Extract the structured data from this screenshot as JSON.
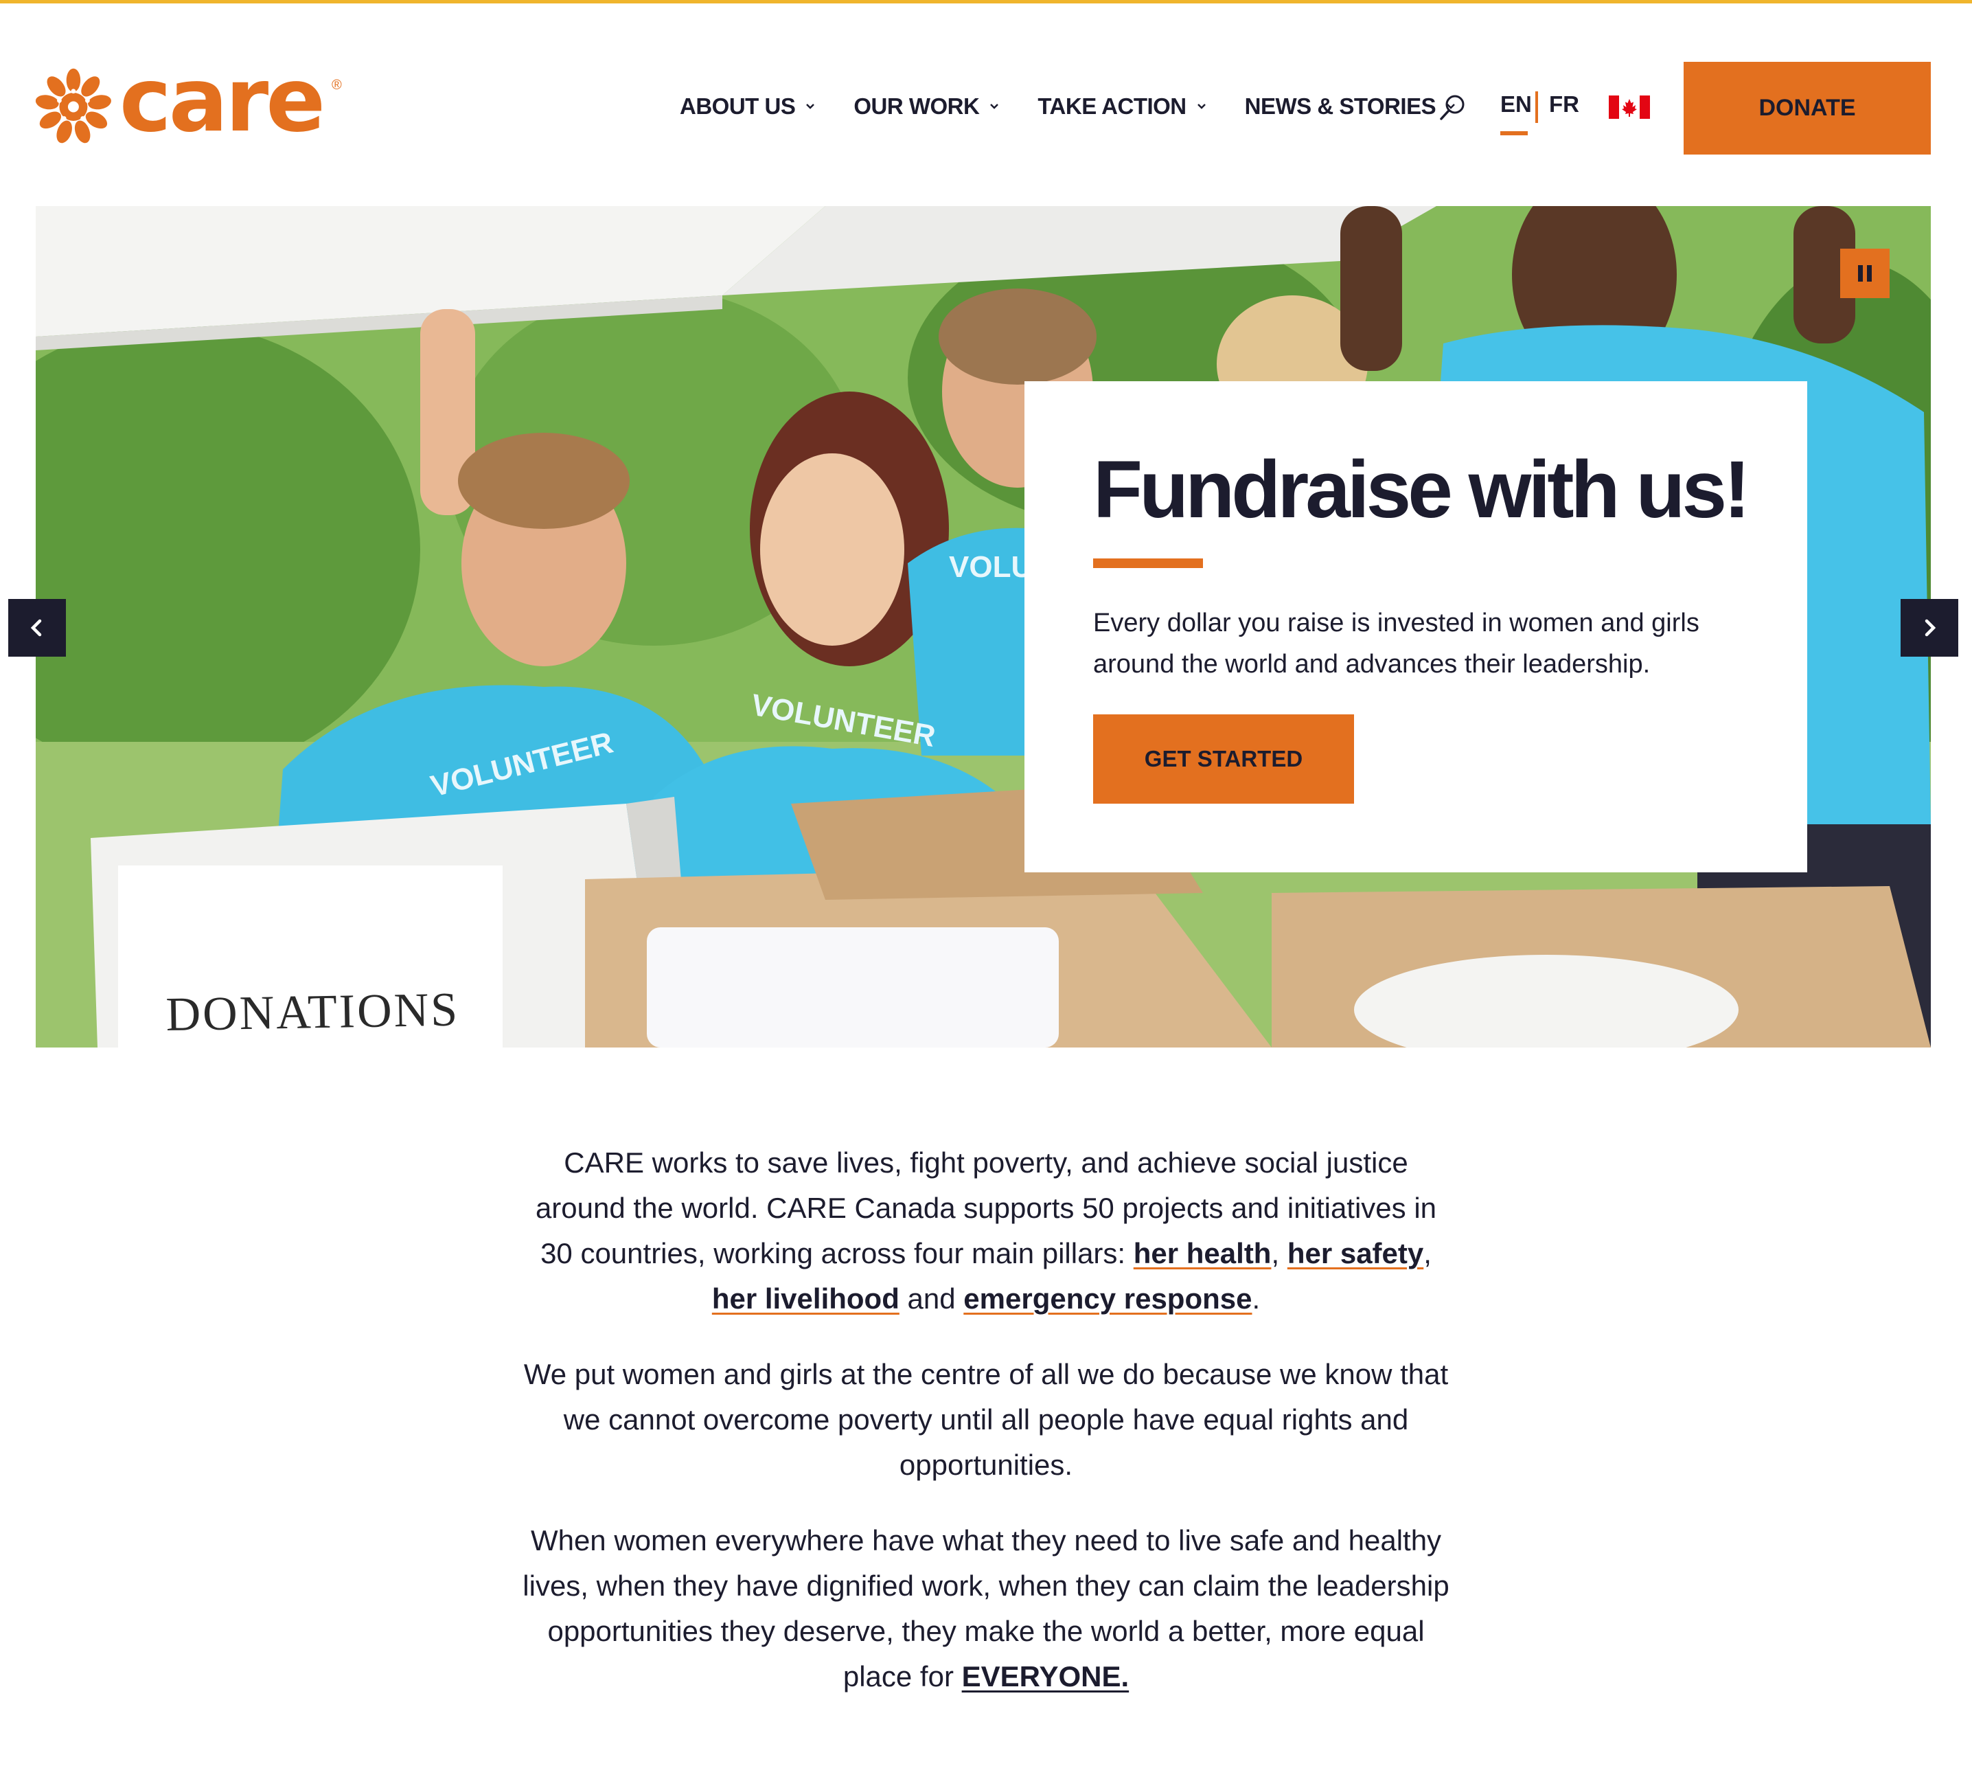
{
  "brand": {
    "name": "care",
    "registered": "®",
    "accent_color": "#e3701f",
    "top_line_color": "#f0b52d",
    "text_color": "#1c1c2e"
  },
  "nav": {
    "items": [
      {
        "label": "ABOUT US"
      },
      {
        "label": "OUR WORK"
      },
      {
        "label": "TAKE ACTION"
      },
      {
        "label": "NEWS & STORIES"
      }
    ],
    "search_icon": "search-icon",
    "lang_en": "EN",
    "lang_fr": "FR",
    "flag_icon": "canada-flag-icon",
    "donate_label": "DONATE"
  },
  "hero": {
    "title": "Fundraise with us!",
    "text": "Every dollar you raise is invested in women and girls around the world and advances their leadership.",
    "cta_label": "GET STARTED",
    "box_label": "DONATIONS",
    "shirt_label_1": "VOLUNTEER",
    "shirt_label_2": "VOLUNTEER",
    "shirt_label_3": "VOLU",
    "pause_icon": "pause-icon",
    "prev_icon": "chevron-left-icon",
    "next_icon": "chevron-right-icon"
  },
  "content": {
    "p1_a": "CARE works to save lives, fight poverty, and achieve social justice around the world. CARE Canada supports 50 projects and initiatives in 30 countries, working across four main pillars: ",
    "link_health": "her health",
    "comma1": ", ",
    "link_safety": "her safety",
    "comma2": ", ",
    "link_livelihood": "her livelihood",
    "and": " and ",
    "link_emergency": "emergency response",
    "period": ".",
    "p2": "We put women and girls at the centre of all we do because we know that we cannot overcome poverty until all people have equal rights and opportunities.",
    "p3_a": "When women everywhere have what they need to live safe and healthy lives, when they have dignified work, when they can claim the leadership opportunities they deserve, they make the world a better, more equal place for ",
    "link_everyone": "EVERYONE."
  }
}
